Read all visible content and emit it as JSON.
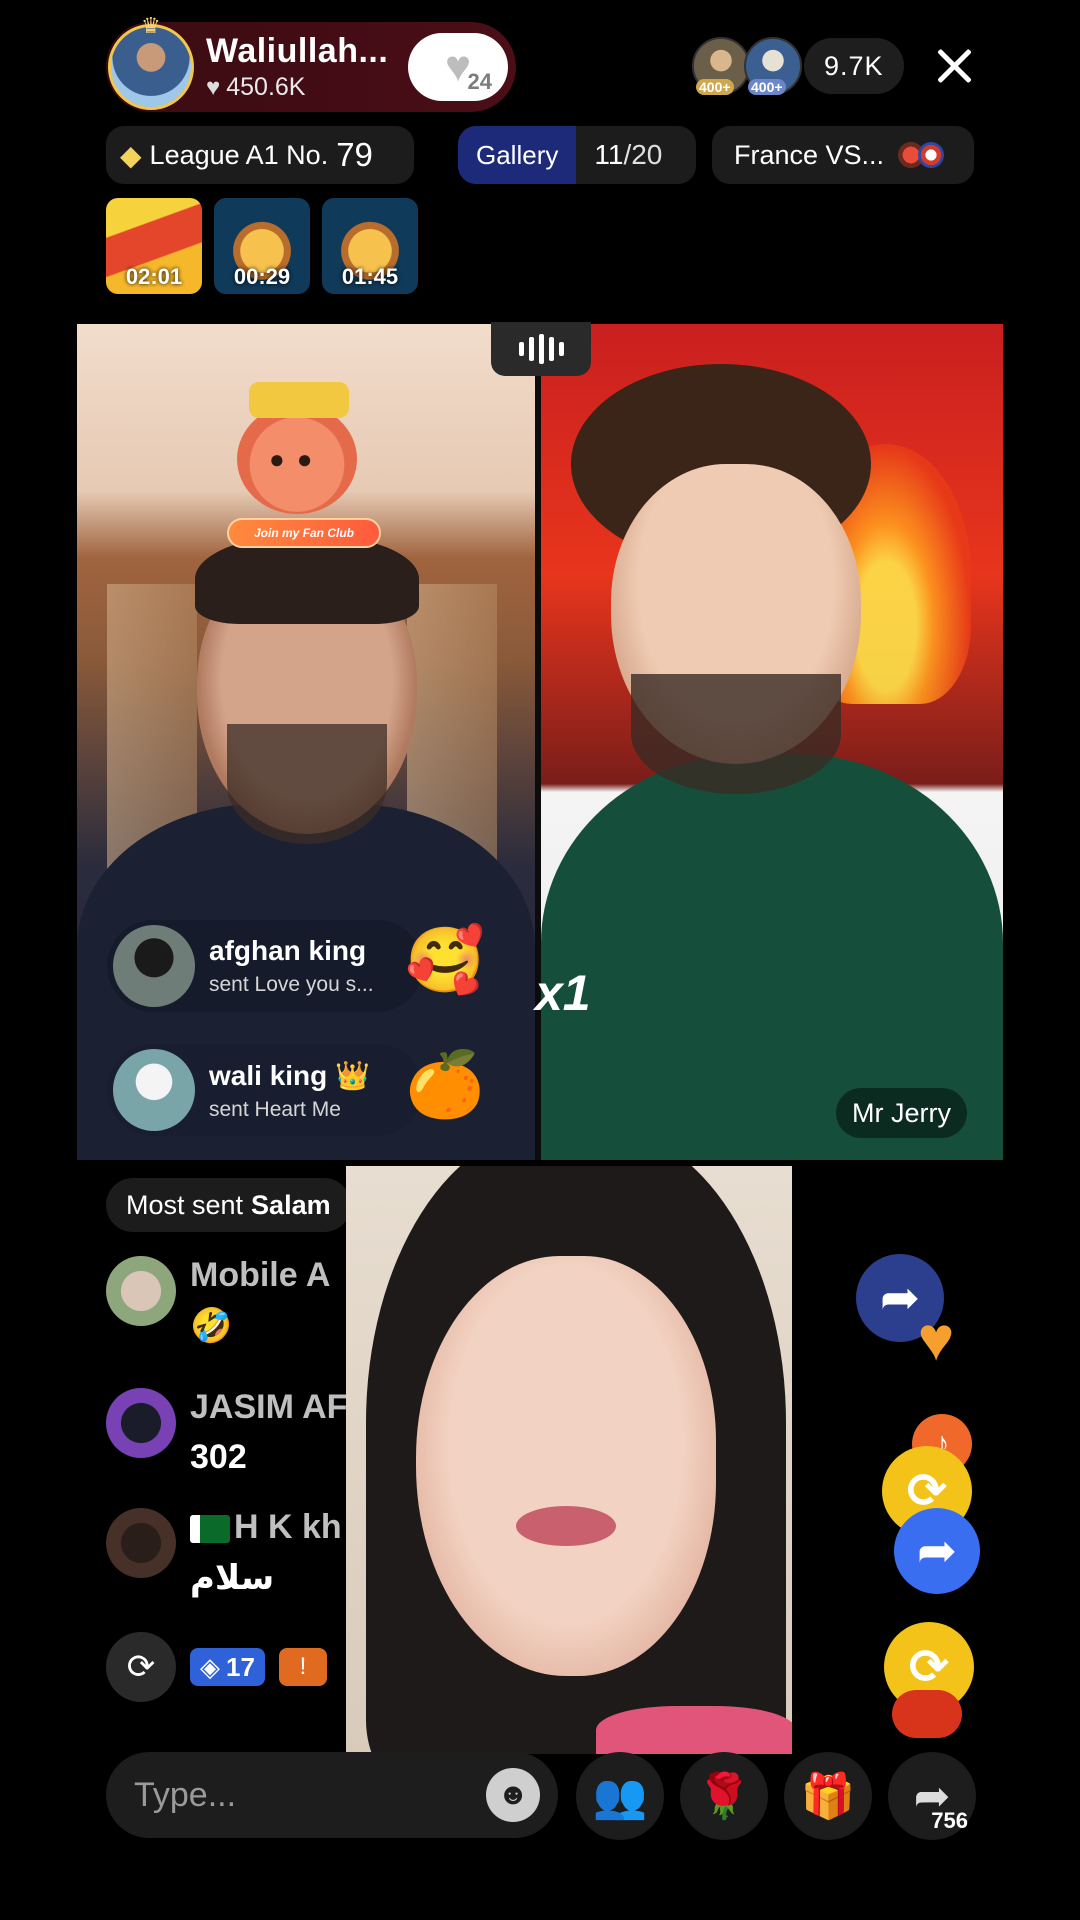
{
  "host": {
    "name": "Waliullah...",
    "likes": "450.6K",
    "follow_count": "24"
  },
  "viewers": {
    "badge1": "400+",
    "badge2": "400+",
    "count": "9.7K"
  },
  "league": {
    "label": "League A1 No.",
    "number": "79"
  },
  "gallery": {
    "label": "Gallery",
    "current": "11",
    "total": "/20"
  },
  "match": {
    "label": "France VS..."
  },
  "chests": [
    {
      "time": "02:01"
    },
    {
      "time": "00:29"
    },
    {
      "time": "01:45"
    }
  ],
  "battle": {
    "fan_club": "Join my Fan Club",
    "combo": "x1",
    "right_name": "Mr Jerry",
    "gifts": [
      {
        "user": "afghan king",
        "message": "sent Love you s...",
        "icon": "hug-heart-emoji"
      },
      {
        "user": "wali king 👑",
        "message": "sent Heart Me",
        "icon": "mascot-gift"
      }
    ]
  },
  "most_sent": {
    "label": "Most sent",
    "gift": "Salam"
  },
  "chat": [
    {
      "name": "Mobile A",
      "message": "🤣"
    },
    {
      "name": "JASIM AF",
      "message": "302"
    },
    {
      "name": "H K kh",
      "message": "سلام",
      "flag": "pakistan-flag"
    }
  ],
  "badges": {
    "level1": "17",
    "level2": "!"
  },
  "input": {
    "placeholder": "Type..."
  },
  "share_count": "756",
  "colors": {
    "host_pill": "#4a0e17",
    "gallery_accent": "#1d2a7a",
    "repost_yellow": "#f3c31a",
    "share_blue": "#3a6ef0"
  }
}
